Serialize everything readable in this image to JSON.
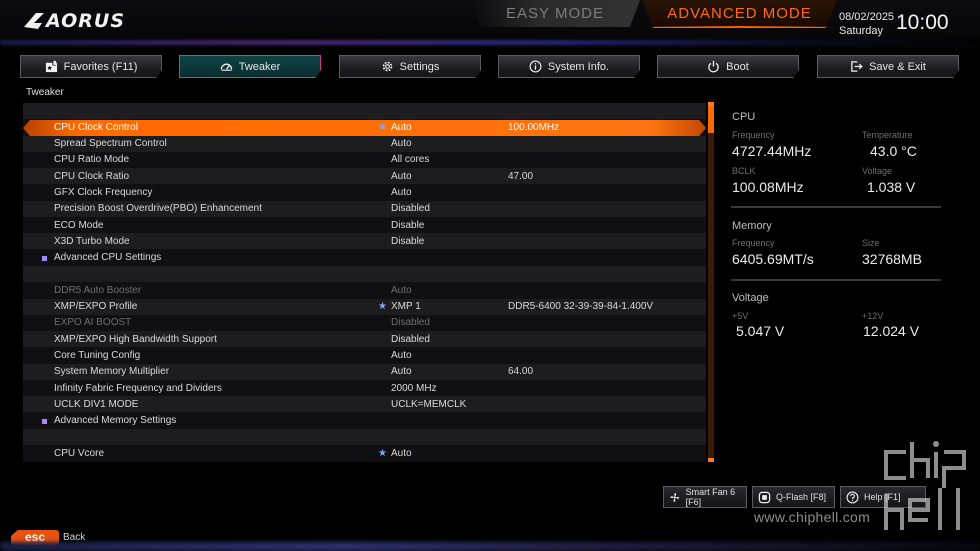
{
  "header": {
    "brand": "AORUS",
    "easy_mode": "EASY MODE",
    "advanced_mode": "ADVANCED MODE",
    "date": "08/02/2025",
    "day": "Saturday",
    "time": "10:00"
  },
  "tabs": [
    {
      "label": "Favorites (F11)",
      "icon": "favorites-icon"
    },
    {
      "label": "Tweaker",
      "icon": "speedometer-icon",
      "active": true
    },
    {
      "label": "Settings",
      "icon": "gear-icon"
    },
    {
      "label": "System Info.",
      "icon": "info-icon"
    },
    {
      "label": "Boot",
      "icon": "power-icon"
    },
    {
      "label": "Save & Exit",
      "icon": "exit-icon"
    }
  ],
  "section_title": "Tweaker",
  "rows": [
    {
      "name": "CPU Clock Control",
      "value": "Auto",
      "value2": "100.00MHz",
      "star": true,
      "selected": true
    },
    {
      "name": "Spread Spectrum Control",
      "value": "Auto"
    },
    {
      "name": "CPU Ratio Mode",
      "value": "All cores"
    },
    {
      "name": "CPU Clock Ratio",
      "value": "Auto",
      "value2": "47.00"
    },
    {
      "name": "GFX Clock Frequency",
      "value": "Auto"
    },
    {
      "name": "Precision Boost Overdrive(PBO) Enhancement",
      "value": "Disabled"
    },
    {
      "name": "ECO Mode",
      "value": "Disable"
    },
    {
      "name": "X3D Turbo Mode",
      "value": "Disable"
    },
    {
      "name": "Advanced CPU Settings",
      "submenu": true
    },
    {
      "name": "DDR5 Auto Booster",
      "value": "Auto",
      "dim": true
    },
    {
      "name": "XMP/EXPO Profile",
      "value": "XMP 1",
      "value2": "DDR5-6400 32-39-39-84-1.400V",
      "star": true
    },
    {
      "name": "EXPO AI BOOST",
      "value": "Disabled",
      "dim": true
    },
    {
      "name": "XMP/EXPO High Bandwidth Support",
      "value": "Disabled"
    },
    {
      "name": "Core Tuning Config",
      "value": "Auto"
    },
    {
      "name": "System Memory Multiplier",
      "value": "Auto",
      "value2": "64.00"
    },
    {
      "name": "Infinity Fabric Frequency and Dividers",
      "value": "2000 MHz"
    },
    {
      "name": "UCLK DIV1 MODE",
      "value": "UCLK=MEMCLK"
    },
    {
      "name": "Advanced Memory Settings",
      "submenu": true
    },
    {
      "name": "CPU Vcore",
      "value": "Auto",
      "star": true
    }
  ],
  "monitor": {
    "cpu": {
      "title": "CPU",
      "frequency_label": "Frequency",
      "frequency": "4727.44MHz",
      "temperature_label": "Temperature",
      "temperature": "43.0 °C",
      "bclk_label": "BCLK",
      "bclk": "100.08MHz",
      "voltage_label": "Voltage",
      "voltage": "1.038 V"
    },
    "memory": {
      "title": "Memory",
      "frequency_label": "Frequency",
      "frequency": "6405.69MT/s",
      "size_label": "Size",
      "size": "32768MB"
    },
    "voltage": {
      "title": "Voltage",
      "p5v_label": "+5V",
      "p5v": "5.047 V",
      "p12v_label": "+12V",
      "p12v": "12.024 V"
    }
  },
  "footer": {
    "smart_fan": "Smart Fan 6 [F6]",
    "qflash": "Q-Flash [F8]",
    "help": "Help [F1]",
    "esc_key": "esc",
    "back": "Back",
    "watermark": "www.chiphell.com"
  },
  "colors": {
    "accent": "#ff6a00",
    "tab_active_border": "#c93a8f",
    "tab_active_bg": "#0f4446",
    "star": "#7ea6ff",
    "submenu_bullet": "#a785ff"
  }
}
